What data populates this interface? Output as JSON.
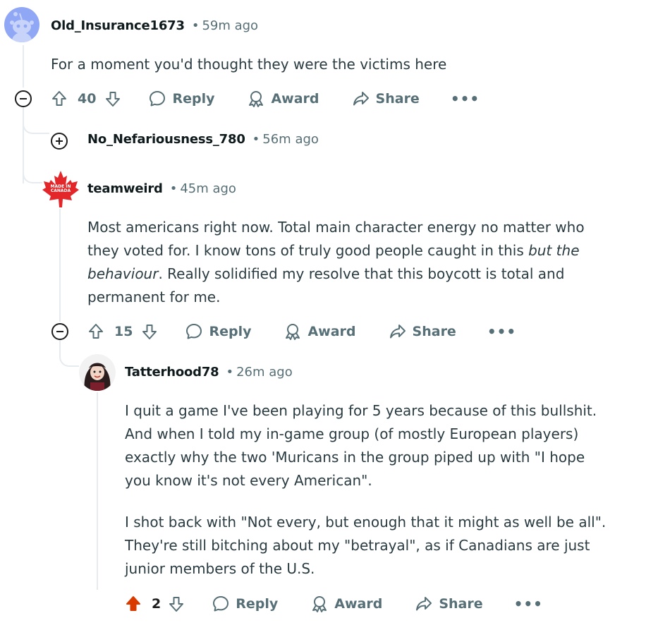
{
  "comments": [
    {
      "author": "Old_Insurance1673",
      "time": "59m ago",
      "body": [
        "For a moment you'd thought they were the victims here"
      ],
      "votes": "40"
    },
    {
      "author": "No_Nefariousness_780",
      "time": "56m ago"
    },
    {
      "author": "teamweird",
      "time": "45m ago",
      "avatar_text": "MADE IN CANADA",
      "body_parts": {
        "a": "Most americans right now. Total main character energy no matter who they voted for. I know tons of truly good people caught in this ",
        "em": "but the behaviour",
        "b": ". Really solidified my resolve that this boycott is total and permanent for me."
      },
      "votes": "15"
    },
    {
      "author": "Tatterhood78",
      "time": "26m ago",
      "body": [
        "I quit a game I've been playing for 5 years because of this bullshit. And when I told my in-game group (of mostly European players) exactly why the two 'Muricans in the group piped up with \"I hope you know it's not every American\".",
        "I shot back with \"Not every, but enough that it might as well be all\". They're still bitching about my \"betrayal\", as if Canadians are just junior members of the U.S."
      ],
      "votes": "2"
    }
  ],
  "actions": {
    "reply": "Reply",
    "award": "Award",
    "share": "Share",
    "more": "•••"
  },
  "meta_sep": "•",
  "colors": {
    "upvoted": "#d93a00",
    "muted": "#576f76",
    "line": "#e5ebee"
  }
}
